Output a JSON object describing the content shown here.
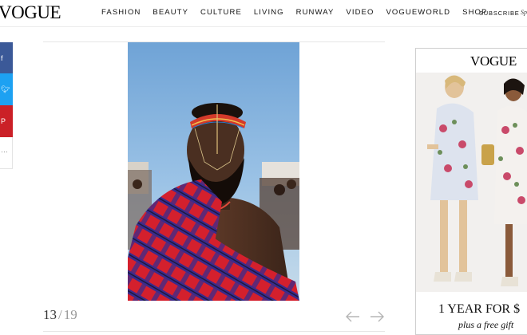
{
  "header": {
    "logo": "VOGUE",
    "nav": [
      "FASHION",
      "BEAUTY",
      "CULTURE",
      "LIVING",
      "RUNWAY",
      "VIDEO",
      "VOGUEWORLD",
      "SHOP"
    ],
    "subscribe": "SUBSCRIBE",
    "subscribe_extra": "Sp"
  },
  "share": {
    "facebook_icon": "facebook-icon",
    "twitter_icon": "twitter-icon",
    "pinterest_icon": "pinterest-icon",
    "more_icon": "more-icon"
  },
  "slideshow": {
    "current": "13",
    "separator": "/",
    "total": "19",
    "prev_icon": "arrow-left-icon",
    "next_icon": "arrow-right-icon"
  },
  "ad": {
    "logo": "VOGUE",
    "headline": "1 YEAR FOR $",
    "subline": "plus a free gift"
  },
  "colors": {
    "facebook": "#3b5998",
    "twitter": "#1da1f2",
    "pinterest": "#cb2027"
  }
}
